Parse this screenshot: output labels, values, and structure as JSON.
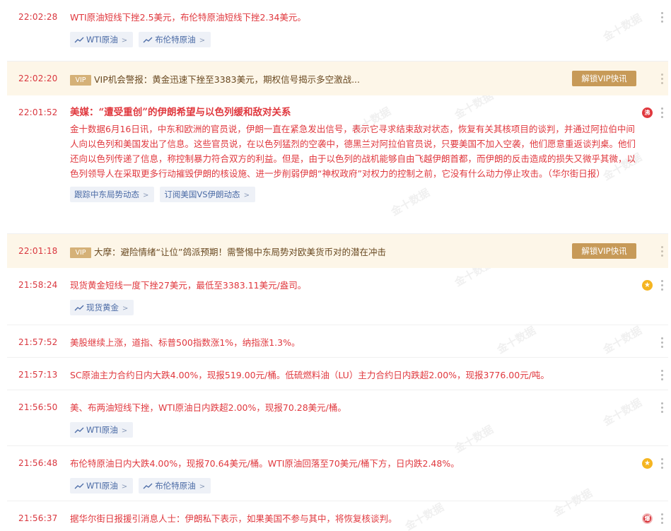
{
  "watermark": "金十数据",
  "ui": {
    "unlock_label": "解锁VIP快讯",
    "vip_label": "VIP"
  },
  "items": [
    {
      "time": "22:02:28",
      "text": "WTI原油短线下挫2.5美元，布伦特原油短线下挫2.34美元。",
      "tags": [
        "WTI原油",
        "布伦特原油"
      ]
    },
    {
      "time": "22:02:20",
      "text": "VIP机会警报：黄金迅速下挫至3383美元，期权信号揭示多空激战..."
    },
    {
      "time": "22:01:52",
      "badge": "沸",
      "headline": "美媒：“遭受重创”的伊朗希望与以色列缓和敌对关系",
      "text": "金十数据6月16日讯，中东和欧洲的官员说，伊朗一直在紧急发出信号，表示它寻求结束敌对状态，恢复有关其核项目的谈判，并通过阿拉伯中间人向以色列和美国发出了信息。这些官员说，在以色列猛烈的空袭中，德黑兰对阿拉伯官员说，只要美国不加入空袭，他们愿意重返谈判桌。他们还向以色列传递了信息，称控制暴力符合双方的利益。但是，由于以色列的战机能够自由飞越伊朗首都，而伊朗的反击造成的损失又微乎其微，以色列领导人在采取更多行动摧毁伊朗的核设施、进一步削弱伊朗“神权政府”对权力的控制之前，它没有什么动力停止攻击。（华尔街日报）",
      "tags": [
        "跟踪中东局势动态",
        "订阅美国VS伊朗动态"
      ]
    },
    {
      "time": "22:01:18",
      "text": "大摩：避险情绪“让位”鸽派预期！需警惕中东局势对欧美货币对的潜在冲击"
    },
    {
      "time": "21:58:24",
      "badge": "★",
      "text": "现货黄金短线一度下挫27美元，最低至3383.11美元/盎司。",
      "tags": [
        "现货黄金"
      ]
    },
    {
      "time": "21:57:52",
      "text": "美股继续上涨，道指、标普500指数涨1%，纳指涨1.3%。"
    },
    {
      "time": "21:57:13",
      "text": "SC原油主力合约日内大跌4.00%，现报519.00元/桶。低硫燃料油（LU）主力合约日内跌超2.00%，现报3776.00元/吨。"
    },
    {
      "time": "21:56:50",
      "text": "美、布两油短线下挫，WTI原油日内跌超2.00%，现报70.28美元/桶。",
      "tags": [
        "WTI原油"
      ]
    },
    {
      "time": "21:56:48",
      "badge": "★",
      "text": "布伦特原油日内大跌4.00%，现报70.64美元/桶。WTI原油回落至70美元/桶下方，日内跌2.48%。",
      "tags": [
        "WTI原油",
        "布伦特原油"
      ]
    },
    {
      "time": "21:56:37",
      "badge": "爆",
      "text": "据华尔街日报援引消息人士：伊朗私下表示，如果美国不参与其中，将恢复核谈判。"
    }
  ]
}
